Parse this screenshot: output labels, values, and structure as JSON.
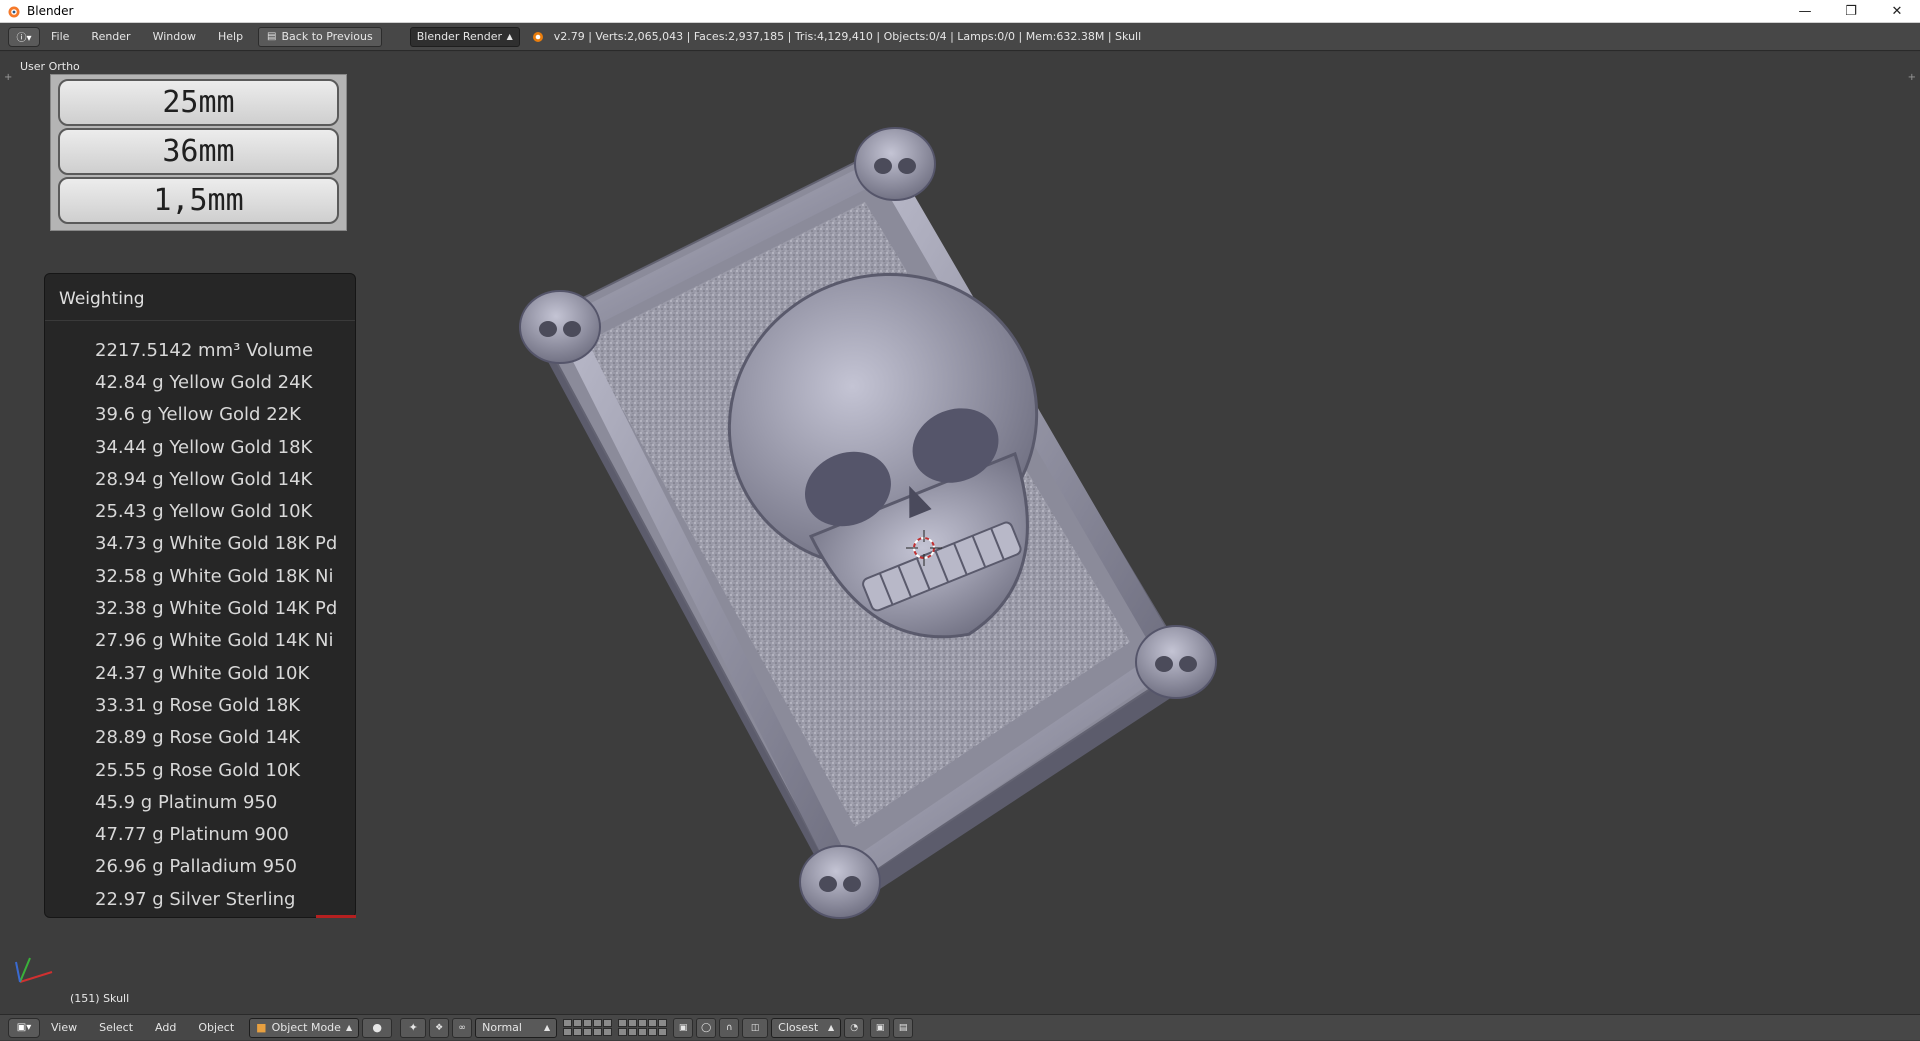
{
  "window": {
    "title": "Blender",
    "buttons": [
      "minimize",
      "restore",
      "close"
    ]
  },
  "topbar": {
    "menus": [
      "File",
      "Render",
      "Window",
      "Help"
    ],
    "back_button": "Back to Previous",
    "render_engine": "Blender Render",
    "stats": "v2.79 | Verts:2,065,043 | Faces:2,937,185 | Tris:4,129,410 | Objects:0/4 | Lamps:0/0 | Mem:632.38M | Skull"
  },
  "viewport": {
    "view_label": "User Ortho",
    "object_label": "(151) Skull"
  },
  "dimensions": [
    "25mm",
    "36mm",
    "1,5mm"
  ],
  "weighting": {
    "title": "Weighting",
    "rows": [
      "2217.5142 mm³  Volume",
      "42.84 g  Yellow Gold 24K",
      "39.6 g  Yellow Gold 22K",
      "34.44 g  Yellow Gold 18K",
      "28.94 g  Yellow Gold 14K",
      "25.43 g  Yellow Gold 10K",
      "34.73 g  White Gold 18K Pd",
      "32.58 g  White Gold 18K Ni",
      "32.38 g  White Gold 14K Pd",
      "27.96 g  White Gold 14K Ni",
      "24.37 g  White Gold 10K",
      "33.31 g  Rose Gold 18K",
      "28.89 g  Rose Gold 14K",
      "25.55 g  Rose Gold 10K",
      "45.9 g  Platinum 950",
      "47.77 g  Platinum 900",
      "26.96 g  Palladium 950",
      "22.97 g  Silver Sterling"
    ]
  },
  "bottombar": {
    "menus": [
      "View",
      "Select",
      "Add",
      "Object"
    ],
    "mode": "Object Mode",
    "pivot": "Normal",
    "snap": "Closest"
  }
}
